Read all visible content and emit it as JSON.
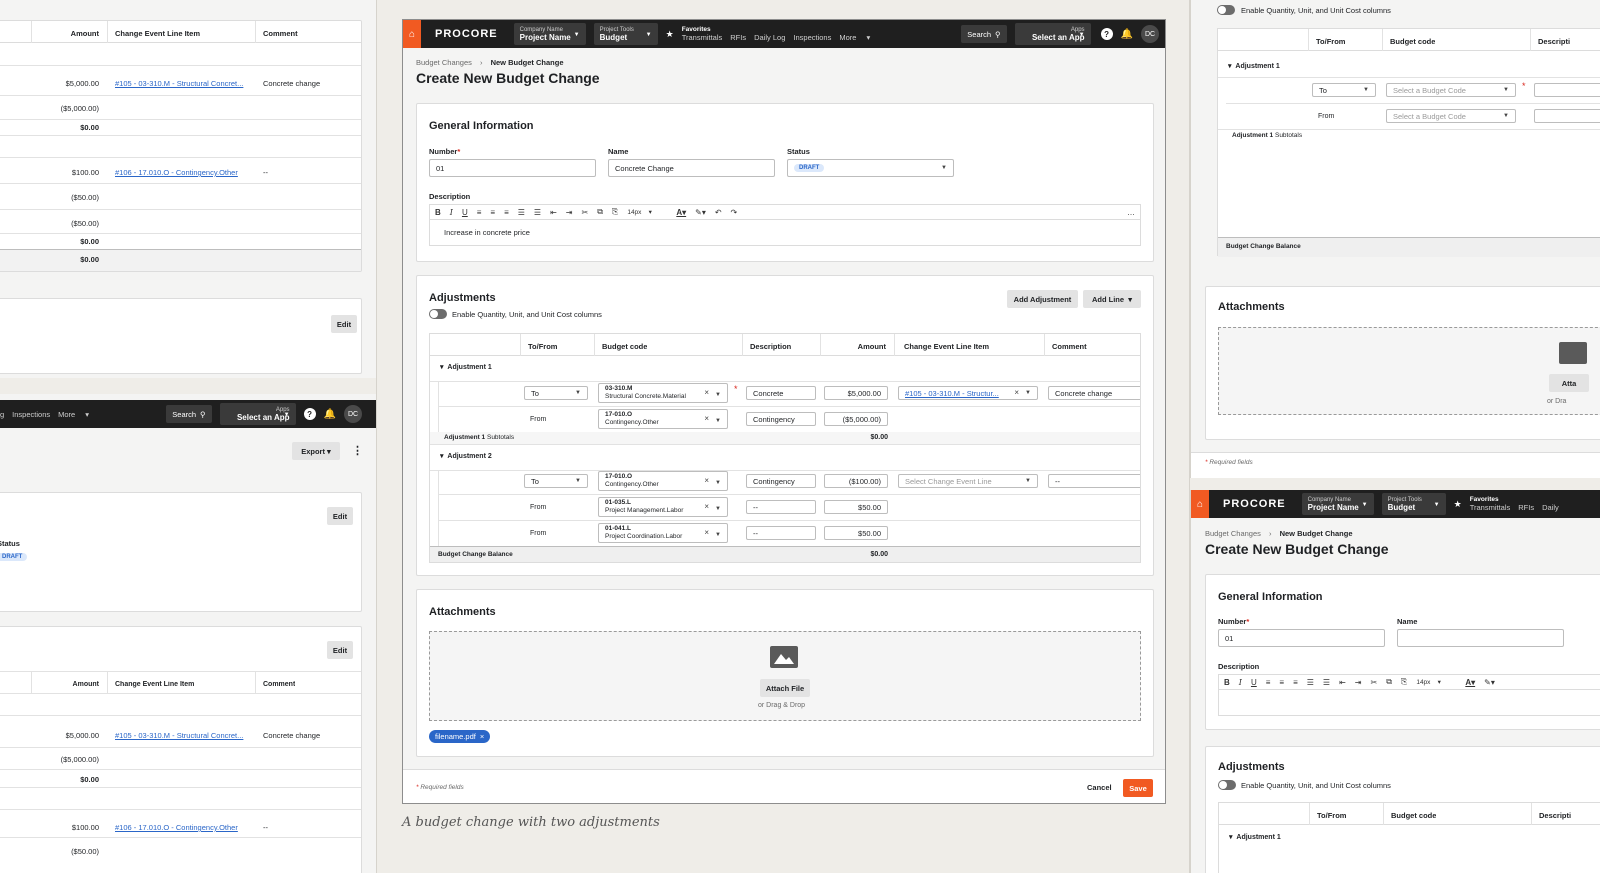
{
  "caption": "A budget change with two adjustments",
  "nav": {
    "logo": "PROCORE",
    "company_small": "Company Name",
    "company_big": "Project Name",
    "tools_small": "Project Tools",
    "tools_big": "Budget",
    "fav_title": "Favorites",
    "fav_links": [
      "Transmittals",
      "RFIs",
      "Daily Log",
      "Inspections"
    ],
    "more": "More",
    "search": "Search",
    "apps_small": "Apps",
    "apps_big": "Select an App",
    "avatar": "DC",
    "help": "?",
    "bell": "🔔"
  },
  "page": {
    "breadcrumb_root": "Budget Changes",
    "breadcrumb_current": "New Budget Change",
    "title": "Create New Budget Change"
  },
  "general": {
    "title": "General Information",
    "number_label": "Number",
    "number_value": "01",
    "name_label": "Name",
    "name_value": "Concrete Change",
    "status_label": "Status",
    "status_value": "DRAFT",
    "description_label": "Description",
    "description_value": "Increase in concrete price",
    "font_size": "14px"
  },
  "adjustments": {
    "title": "Adjustments",
    "add_adjustment": "Add Adjustment",
    "add_line": "Add Line",
    "toggle_label": "Enable Quantity, Unit, and Unit Cost columns",
    "headers": [
      "To/From",
      "Budget code",
      "Description",
      "Amount",
      "Change Event Line Item",
      "Comment"
    ],
    "adj1_label": "Adjustment 1",
    "adj1_subtotal": "Adjustment 1",
    "subtotals_word": "Subtotals",
    "adj1_subtotal_value": "$0.00",
    "adj2_label": "Adjustment 2",
    "balance_label": "Budget Change Balance",
    "balance_value": "$0.00",
    "rows": [
      {
        "tofrom": "To",
        "code1": "03-310.M",
        "code2": "Structural Concrete.Material",
        "desc": "Concrete",
        "amount": "$5,000.00",
        "cei": "#105 - 03-310.M - Structur...",
        "comment": "Concrete change"
      },
      {
        "tofrom": "From",
        "code1": "17-010.O",
        "code2": "Contingency.Other",
        "desc": "Contingency",
        "amount": "($5,000.00)"
      },
      {
        "tofrom": "To",
        "code1": "17-010.O",
        "code2": "Contingency.Other",
        "desc": "Contingency",
        "amount": "($100.00)",
        "cei": "Select Change Event Line",
        "comment": "--"
      },
      {
        "tofrom": "From",
        "code1": "01-035.L",
        "code2": "Project Management.Labor",
        "desc": "--",
        "amount": "$50.00"
      },
      {
        "tofrom": "From",
        "code1": "01-041.L",
        "code2": "Project Coordination.Labor",
        "desc": "--",
        "amount": "$50.00"
      }
    ]
  },
  "attachments": {
    "title": "Attachments",
    "attach_file": "Attach File",
    "drag_drop": "or Drag & Drop",
    "chip": "filename.pdf"
  },
  "footer": {
    "required": "Required fields",
    "cancel": "Cancel",
    "save": "Save"
  },
  "left_top": {
    "headers": [
      "Amount",
      "Change Event Line Item",
      "Comment"
    ],
    "rows": [
      {
        "amount": "$5,000.00",
        "cei": "#105 - 03-310.M - Structural Concret...",
        "comment": "Concrete change"
      },
      {
        "amount": "($5,000.00)"
      },
      {
        "amount": "$0.00"
      },
      {
        "amount": "$100.00",
        "cei": "#106 - 17.010.O - Contingency.Other",
        "comment": "--"
      },
      {
        "amount": "($50.00)"
      },
      {
        "amount": "($50.00)"
      },
      {
        "amount": "$0.00"
      },
      {
        "amount": "$0.00"
      }
    ],
    "edit": "Edit"
  },
  "left_bottom": {
    "nav_links": [
      "g",
      "Inspections"
    ],
    "more": "More",
    "search": "Search",
    "apps_small": "Apps",
    "apps_big": "Select an App",
    "avatar": "DC",
    "export": "Export",
    "edit1": "Edit",
    "status_label": "Status",
    "status_value": "DRAFT",
    "edit2": "Edit",
    "headers": [
      "Amount",
      "Change Event Line Item",
      "Comment"
    ],
    "rows": [
      {
        "amount": "$5,000.00",
        "cei": "#105 - 03-310.M - Structural Concret...",
        "comment": "Concrete change"
      },
      {
        "amount": "($5,000.00)"
      },
      {
        "amount": "$0.00"
      },
      {
        "amount": "$100.00",
        "cei": "#106 - 17.010.O - Contingency.Other",
        "comment": "--"
      },
      {
        "amount": "($50.00)"
      }
    ]
  },
  "right_top": {
    "toggle_label": "Enable Quantity, Unit, and Unit Cost columns",
    "headers": [
      "To/From",
      "Budget code",
      "Descripti"
    ],
    "adj1": "Adjustment 1",
    "to": "To",
    "from": "From",
    "select_code": "Select a Budget Code",
    "subtotal": "Adjustment 1",
    "subtotals_word": "Subtotals",
    "balance": "Budget Change Balance",
    "attachments": "Attachments",
    "atta": "Atta",
    "ordra": "or Dra",
    "required": "Required fields"
  },
  "right_bottom": {
    "logo": "PROCORE",
    "company_small": "Company Name",
    "company_big": "Project Name",
    "tools_small": "Project Tools",
    "tools_big": "Budget",
    "fav_title": "Favorites",
    "fav_links": [
      "Transmittals",
      "RFIs",
      "Daily"
    ],
    "breadcrumb_root": "Budget Changes",
    "breadcrumb_current": "New Budget Change",
    "title": "Create New Budget Change",
    "general": "General Information",
    "number_label": "Number",
    "number_value": "01",
    "name_label": "Name",
    "description_label": "Description",
    "font_size": "14px",
    "adjustments": "Adjustments",
    "toggle_label": "Enable Quantity, Unit, and Unit Cost columns",
    "headers": [
      "To/From",
      "Budget code",
      "Descripti"
    ],
    "adj1": "Adjustment 1"
  }
}
